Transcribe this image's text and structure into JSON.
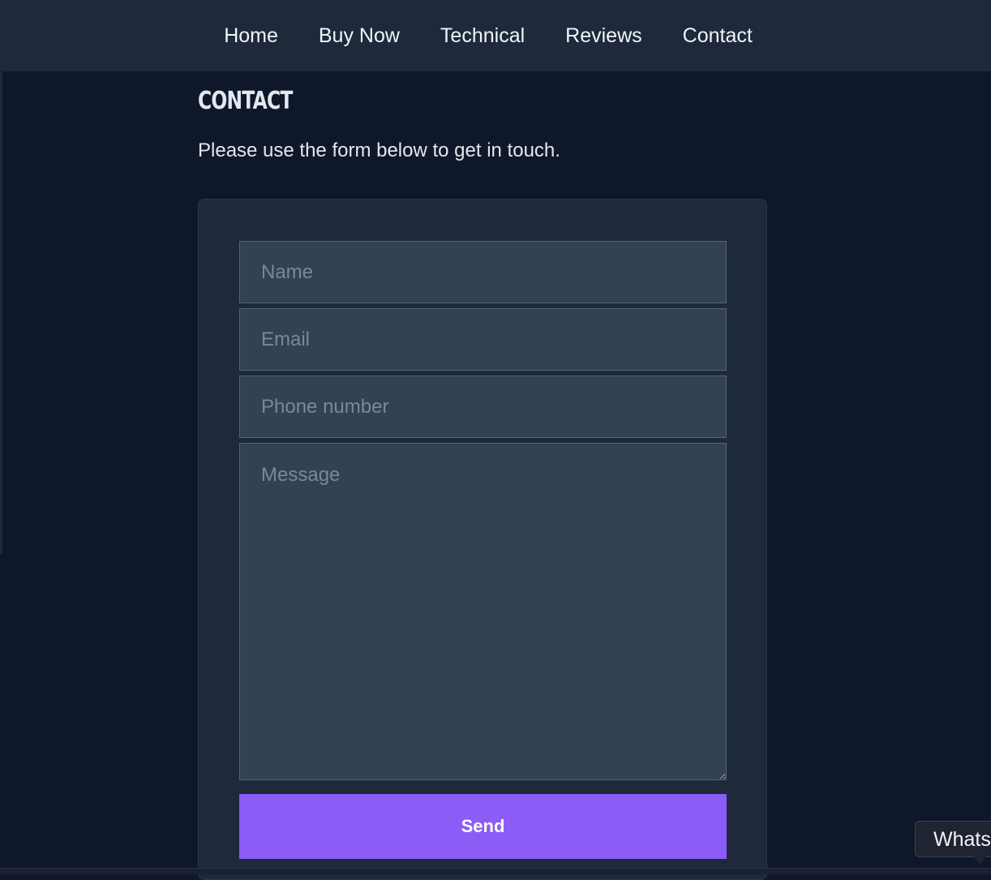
{
  "nav": {
    "items": [
      {
        "label": "Home"
      },
      {
        "label": "Buy Now"
      },
      {
        "label": "Technical"
      },
      {
        "label": "Reviews"
      },
      {
        "label": "Contact"
      }
    ]
  },
  "page": {
    "title": "Contact",
    "intro": "Please use the form below to get in touch."
  },
  "form": {
    "name_placeholder": "Name",
    "email_placeholder": "Email",
    "phone_placeholder": "Phone number",
    "message_placeholder": "Message",
    "send_label": "Send"
  },
  "chat_widget": {
    "label": "WhatsApp"
  },
  "colors": {
    "background": "#0f172a",
    "nav_background": "#1e293b",
    "field_background": "#334155",
    "accent": "#8b5cf6"
  }
}
